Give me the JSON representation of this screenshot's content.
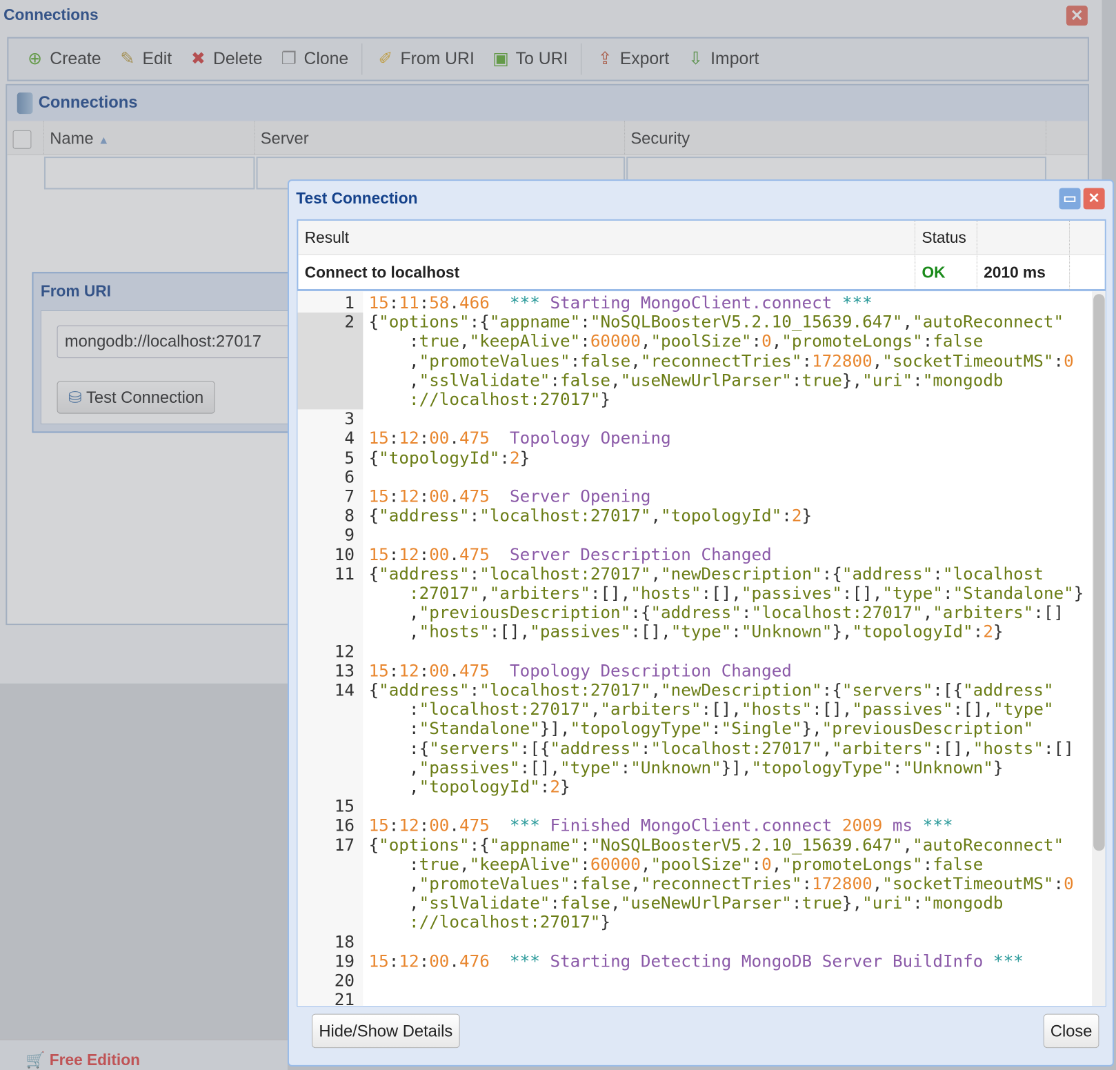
{
  "app": {
    "title": "Connections",
    "close_icon": "close-icon"
  },
  "toolbar": [
    {
      "label": "Create",
      "icon": "plus-circle-icon",
      "glyph": "⊕",
      "color": "#5aa82f"
    },
    {
      "label": "Edit",
      "icon": "edit-icon",
      "glyph": "✎",
      "color": "#b89a40"
    },
    {
      "label": "Delete",
      "icon": "delete-x-icon",
      "glyph": "✖",
      "color": "#d03a3a"
    },
    {
      "label": "Clone",
      "icon": "clone-icon",
      "glyph": "❐",
      "color": "#888888"
    },
    {
      "sep": true
    },
    {
      "label": "From URI",
      "icon": "from-uri-icon",
      "glyph": "✐",
      "color": "#e0b030"
    },
    {
      "label": "To URI",
      "icon": "to-uri-icon",
      "glyph": "▣",
      "color": "#5aa82f"
    },
    {
      "sep": true
    },
    {
      "label": "Export",
      "icon": "export-icon",
      "glyph": "⇪",
      "color": "#c05030"
    },
    {
      "label": "Import",
      "icon": "import-icon",
      "glyph": "⇩",
      "color": "#4a9a30"
    }
  ],
  "panel": {
    "title": "Connections",
    "columns": {
      "name": "Name",
      "server": "Server",
      "security": "Security"
    }
  },
  "from_uri": {
    "title": "From URI",
    "uri_value": "mongodb://localhost:27017",
    "test_button": "Test Connection"
  },
  "status_bar": {
    "edition": "Free Edition"
  },
  "dialog": {
    "title": "Test Connection",
    "result_header": {
      "result": "Result",
      "status": "Status"
    },
    "result_row": {
      "result": "Connect to localhost",
      "status": "OK",
      "time": "2010 ms",
      "status_color": "#1a8a1a"
    },
    "hide_show_button": "Hide/Show Details",
    "close_button": "Close",
    "log_lines": [
      {
        "n": 1,
        "parts": [
          "15:11:58.466  *** Starting MongoClient.connect ***"
        ]
      },
      {
        "n": 2,
        "active": true,
        "parts": [
          "{\"options\":{\"appname\":\"NoSQLBoosterV5.2.10_15639.647\",\"autoReconnect\"",
          ":true,\"keepAlive\":60000,\"poolSize\":0,\"promoteLongs\":false",
          ",\"promoteValues\":false,\"reconnectTries\":172800,\"socketTimeoutMS\":0",
          ",\"sslValidate\":false,\"useNewUrlParser\":true},\"uri\":\"mongodb",
          "://localhost:27017\"}"
        ]
      },
      {
        "n": 3,
        "parts": [
          ""
        ]
      },
      {
        "n": 4,
        "parts": [
          "15:12:00.475  Topology Opening"
        ]
      },
      {
        "n": 5,
        "parts": [
          "{\"topologyId\":2}"
        ]
      },
      {
        "n": 6,
        "parts": [
          ""
        ]
      },
      {
        "n": 7,
        "parts": [
          "15:12:00.475  Server Opening"
        ]
      },
      {
        "n": 8,
        "parts": [
          "{\"address\":\"localhost:27017\",\"topologyId\":2}"
        ]
      },
      {
        "n": 9,
        "parts": [
          ""
        ]
      },
      {
        "n": 10,
        "parts": [
          "15:12:00.475  Server Description Changed"
        ]
      },
      {
        "n": 11,
        "parts": [
          "{\"address\":\"localhost:27017\",\"newDescription\":{\"address\":\"localhost",
          ":27017\",\"arbiters\":[],\"hosts\":[],\"passives\":[],\"type\":\"Standalone\"}",
          ",\"previousDescription\":{\"address\":\"localhost:27017\",\"arbiters\":[]",
          ",\"hosts\":[],\"passives\":[],\"type\":\"Unknown\"},\"topologyId\":2}"
        ]
      },
      {
        "n": 12,
        "parts": [
          ""
        ]
      },
      {
        "n": 13,
        "parts": [
          "15:12:00.475  Topology Description Changed"
        ]
      },
      {
        "n": 14,
        "parts": [
          "{\"address\":\"localhost:27017\",\"newDescription\":{\"servers\":[{\"address\"",
          ":\"localhost:27017\",\"arbiters\":[],\"hosts\":[],\"passives\":[],\"type\"",
          ":\"Standalone\"}],\"topologyType\":\"Single\"},\"previousDescription\"",
          ":{\"servers\":[{\"address\":\"localhost:27017\",\"arbiters\":[],\"hosts\":[]",
          ",\"passives\":[],\"type\":\"Unknown\"}],\"topologyType\":\"Unknown\"}",
          ",\"topologyId\":2}"
        ]
      },
      {
        "n": 15,
        "parts": [
          ""
        ]
      },
      {
        "n": 16,
        "parts": [
          "15:12:00.475  *** Finished MongoClient.connect 2009 ms ***"
        ]
      },
      {
        "n": 17,
        "parts": [
          "{\"options\":{\"appname\":\"NoSQLBoosterV5.2.10_15639.647\",\"autoReconnect\"",
          ":true,\"keepAlive\":60000,\"poolSize\":0,\"promoteLongs\":false",
          ",\"promoteValues\":false,\"reconnectTries\":172800,\"socketTimeoutMS\":0",
          ",\"sslValidate\":false,\"useNewUrlParser\":true},\"uri\":\"mongodb",
          "://localhost:27017\"}"
        ]
      },
      {
        "n": 18,
        "parts": [
          ""
        ]
      },
      {
        "n": 19,
        "parts": [
          "15:12:00.476  *** Starting Detecting MongoDB Server BuildInfo ***"
        ]
      },
      {
        "n": 20,
        "parts": [
          ""
        ]
      },
      {
        "n": 21,
        "parts": [
          ""
        ]
      }
    ]
  }
}
